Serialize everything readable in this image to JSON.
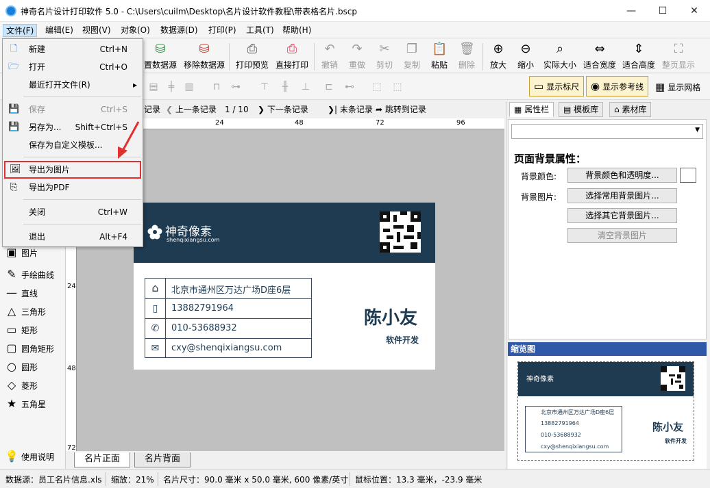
{
  "window": {
    "title": "神奇名片设计打印软件 5.0 - C:\\Users\\cuilm\\Desktop\\名片设计软件教程\\带表格名片.bscp",
    "minimize": "—",
    "maximize": "☐",
    "close": "✕"
  },
  "menubar": [
    "文件(F)",
    "编辑(E)",
    "视图(V)",
    "对象(O)",
    "数据源(D)",
    "打印(P)",
    "工具(T)",
    "帮助(H)"
  ],
  "toolbar1": {
    "set_datasource": "置数据源",
    "remove_datasource": "移除数据源",
    "print_preview": "打印预览",
    "direct_print": "直接打印",
    "undo": "撤销",
    "redo": "重做",
    "cut": "剪切",
    "copy": "复制",
    "paste": "粘贴",
    "delete": "删除",
    "zoom_in": "放大",
    "zoom_out": "缩小",
    "actual_size": "实际大小",
    "fit_width": "适合宽度",
    "fit_height": "适合高度",
    "fit_page": "整页显示"
  },
  "toolbar2": {
    "show_ruler": "显示标尺",
    "show_guides": "显示参考线",
    "show_grid": "显示网格"
  },
  "navbar": {
    "first": "记录",
    "prev": "上一条记录",
    "counter": "1 / 10",
    "next": "下一条记录",
    "last": "末条记录",
    "goto": "跳转到记录"
  },
  "ruler": {
    "top": [
      "24",
      "48",
      "72",
      "96"
    ],
    "left": [
      "24",
      "48",
      "72"
    ]
  },
  "card": {
    "brand": "神奇像素",
    "brand_sub": "shenqixiangsu.com",
    "address": "北京市通州区万达广场D座6层",
    "mobile": "13882791964",
    "phone": "010-53688932",
    "email": "cxy@shenqixiangsu.com",
    "name": "陈小友",
    "job": "软件开发"
  },
  "left_panel": {
    "image": "图片",
    "freehand": "手绘曲线",
    "line": "直线",
    "triangle": "三角形",
    "rect": "矩形",
    "round_rect": "圆角矩形",
    "circle": "圆形",
    "diamond": "菱形",
    "star": "五角星",
    "help": "使用说明"
  },
  "bottom_tabs": {
    "front": "名片正面",
    "back": "名片背面"
  },
  "right_panel": {
    "tabs": [
      "属性栏",
      "模板库",
      "素材库"
    ],
    "section_title": "页面背景属性：",
    "bg_color_label": "背景颜色:",
    "bg_color_button": "背景颜色和透明度...",
    "bg_image_label": "背景图片:",
    "common_bg_button": "选择常用背景图片...",
    "other_bg_button": "选择其它背景图片...",
    "clear_bg_button": "清空背景图片",
    "preview_title": "缩览图"
  },
  "statusbar": {
    "datasource": "数据源：员工名片信息.xls",
    "zoom": "缩放：21%",
    "size": "名片尺寸：90.0 毫米 x 50.0 毫米, 600 像素/英寸",
    "mouse": "鼠标位置：13.3 毫米，-23.9 毫米"
  },
  "file_menu": {
    "new": {
      "label": "新建",
      "shortcut": "Ctrl+N"
    },
    "open": {
      "label": "打开",
      "shortcut": "Ctrl+O"
    },
    "recent": {
      "label": "最近打开文件(R)",
      "arrow": "▸"
    },
    "save": {
      "label": "保存",
      "shortcut": "Ctrl+S"
    },
    "save_as": {
      "label": "另存为...",
      "shortcut": "Shift+Ctrl+S"
    },
    "save_template": {
      "label": "保存为自定义模板..."
    },
    "export_image": {
      "label": "导出为图片"
    },
    "export_pdf": {
      "label": "导出为PDF"
    },
    "close": {
      "label": "关闭",
      "shortcut": "Ctrl+W"
    },
    "exit": {
      "label": "退出",
      "shortcut": "Alt+F4"
    }
  },
  "colors": {
    "card_band": "#1f3b52",
    "highlight": "#e0302f",
    "preview_head": "#3058a8"
  },
  "icons": [
    "app-icon",
    "new-icon",
    "open-icon",
    "save-icon",
    "save-as-icon",
    "export-image-icon",
    "export-pdf-icon",
    "home-icon",
    "mobile-icon",
    "phone-icon",
    "mail-icon",
    "qr-code",
    "lightbulb-icon"
  ]
}
